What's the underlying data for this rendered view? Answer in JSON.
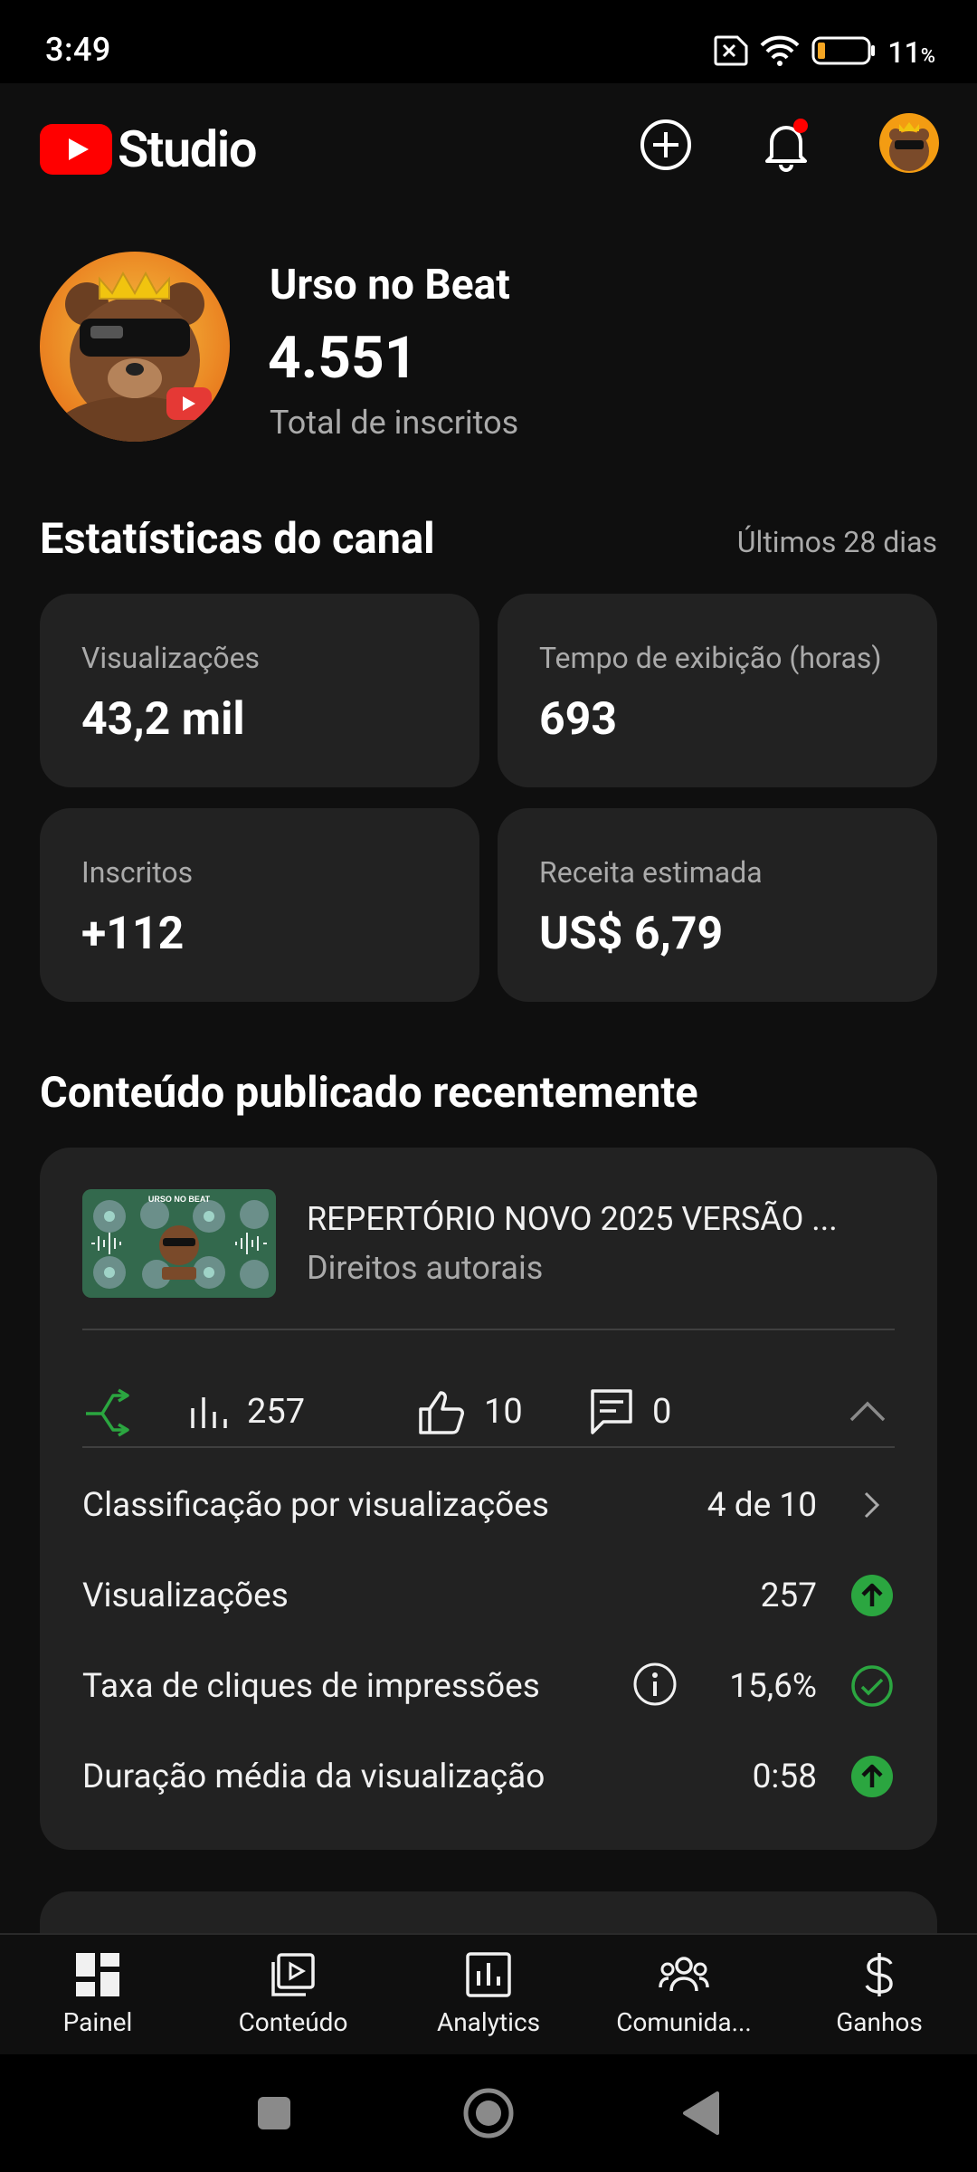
{
  "status_bar": {
    "time": "3:49",
    "battery": "11",
    "battery_unit": "%"
  },
  "header": {
    "app_name": "Studio"
  },
  "channel": {
    "name": "Urso no Beat",
    "subscribers": "4.551",
    "subscribers_label": "Total de inscritos"
  },
  "stats": {
    "title": "Estatísticas do canal",
    "period": "Últimos 28 dias",
    "cards": [
      {
        "label": "Visualizações",
        "value": "43,2 mil"
      },
      {
        "label": "Tempo de exibição (horas)",
        "value": "693"
      },
      {
        "label": "Inscritos",
        "value": "+112"
      },
      {
        "label": "Receita estimada",
        "value": "US$ 6,79"
      }
    ]
  },
  "recent": {
    "title": "Conteúdo publicado recentemente",
    "video": {
      "thumbnail_text": "URSO NO BEAT",
      "title": "REPERTÓRIO NOVO 2025 VERSÃO ...",
      "subtitle": "Direitos autorais",
      "views": "257",
      "likes": "10",
      "comments": "0"
    },
    "details": [
      {
        "label": "Classificação por visualizações",
        "value": "4 de 10"
      },
      {
        "label": "Visualizações",
        "value": "257"
      },
      {
        "label": "Taxa de cliques de impressões",
        "value": "15,6%"
      },
      {
        "label": "Duração média da visualização",
        "value": "0:58"
      }
    ]
  },
  "bottom_nav": {
    "items": [
      {
        "label": "Painel"
      },
      {
        "label": "Conteúdo"
      },
      {
        "label": "Analytics"
      },
      {
        "label": "Comunida..."
      },
      {
        "label": "Ganhos"
      }
    ]
  },
  "colors": {
    "accent_green": "#2ba640",
    "brand_red": "#ff0000",
    "card_bg": "#222222"
  }
}
